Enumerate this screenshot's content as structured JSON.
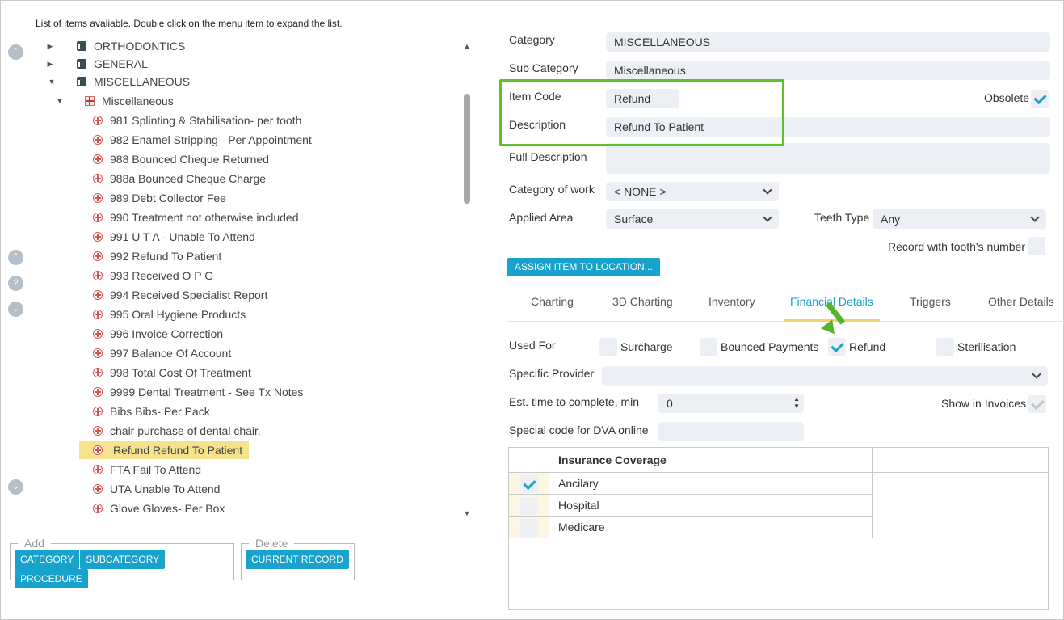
{
  "hint": "List of items avaliable. Double click on the menu item to expand the list.",
  "nav_buttons": [
    {
      "name": "scroll-top-icon",
      "glyph": "⌃"
    },
    {
      "name": "scroll-up-icon",
      "glyph": "⌃"
    },
    {
      "name": "help-icon",
      "glyph": "?"
    },
    {
      "name": "scroll-down-icon",
      "glyph": "⌄"
    },
    {
      "name": "scroll-bottom-icon",
      "glyph": "⌄"
    }
  ],
  "tree": {
    "categories": [
      "ORTHODONTICS",
      "GENERAL",
      "MISCELLANEOUS"
    ],
    "subcategory": "Miscellaneous",
    "items": [
      "981 Splinting & Stabilisation- per tooth",
      "982 Enamel Stripping - Per Appointment",
      "988 Bounced Cheque Returned",
      "988a Bounced Cheque Charge",
      "989 Debt Collector Fee",
      "990 Treatment not otherwise included",
      "991 U T A - Unable To Attend",
      "992 Refund To Patient",
      "993 Received O P G",
      "994 Received Specialist Report",
      "995 Oral Hygiene Products",
      "996 Invoice Correction",
      "997 Balance Of Account",
      "998 Total Cost Of Treatment",
      "9999 Dental Treatment - See Tx Notes",
      "Bibs Bibs- Per Pack",
      "chair purchase of dental chair.",
      "Refund Refund To Patient",
      "FTA Fail To Attend",
      "UTA Unable To Attend",
      "Glove Gloves- Per Box"
    ],
    "selected_item": "Refund Refund To Patient"
  },
  "add_group": {
    "legend": "Add",
    "buttons": [
      "CATEGORY",
      "SUBCATEGORY",
      "PROCEDURE"
    ]
  },
  "delete_group": {
    "legend": "Delete",
    "buttons": [
      "CURRENT RECORD"
    ]
  },
  "form": {
    "category_label": "Category",
    "category_value": "MISCELLANEOUS",
    "subcategory_label": "Sub Category",
    "subcategory_value": "Miscellaneous",
    "item_code_label": "Item Code",
    "item_code_value": "Refund",
    "obsolete_label": "Obsolete",
    "obsolete_checked": true,
    "description_label": "Description",
    "description_value": "Refund To Patient",
    "full_description_label": "Full Description",
    "full_description_value": "",
    "category_of_work_label": "Category of work",
    "category_of_work_value": "< NONE >",
    "applied_area_label": "Applied Area",
    "applied_area_value": "Surface",
    "teeth_type_label": "Teeth Type",
    "teeth_type_value": "Any",
    "record_tooth_label": "Record with tooth's number",
    "assign_button": "ASSIGN ITEM TO LOCATION..."
  },
  "tabs": [
    "Charting",
    "3D Charting",
    "Inventory",
    "Financial Details",
    "Triggers",
    "Other Details"
  ],
  "active_tab": "Financial Details",
  "financial": {
    "used_for_label": "Used For",
    "used_for": [
      {
        "label": "Surcharge",
        "checked": false
      },
      {
        "label": "Bounced Payments",
        "checked": false
      },
      {
        "label": "Refund",
        "checked": true
      },
      {
        "label": "Sterilisation",
        "checked": false
      }
    ],
    "specific_provider_label": "Specific Provider",
    "specific_provider_value": "",
    "est_time_label": "Est. time to complete, min",
    "est_time_value": "0",
    "show_in_invoices_label": "Show in Invoices",
    "show_in_invoices_checked": true,
    "dva_label": "Special code for DVA online",
    "dva_value": ""
  },
  "insurance": {
    "header": "Insurance Coverage",
    "rows": [
      {
        "label": "Ancilary",
        "checked": true
      },
      {
        "label": "Hospital",
        "checked": false
      },
      {
        "label": "Medicare",
        "checked": false
      }
    ]
  },
  "colors": {
    "accent": "#17a3cc",
    "highlight_box": "#5dc12b",
    "selected_row": "#f7e38f",
    "tab_underline": "#f3d36b"
  }
}
